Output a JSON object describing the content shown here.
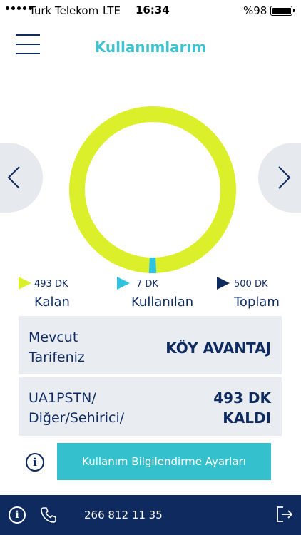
{
  "status_bar": {
    "carrier": "Turk Telekom",
    "network": "LTE",
    "time": "16:34",
    "battery": "%98"
  },
  "header": {
    "title": "Kullanımlarım",
    "menu_icon": "hamburger-menu-icon"
  },
  "usage": {
    "remaining_minutes": 493,
    "used_minutes": 7,
    "total_minutes": 500,
    "colors": {
      "remaining": "#dbef2a",
      "used": "#2fc3e0",
      "total": "#0e2a5e"
    }
  },
  "legend": [
    {
      "value": "493 DK",
      "label": "Kalan"
    },
    {
      "value": "7 DK",
      "label": "Kullanılan"
    },
    {
      "value": "500 DK",
      "label": "Toplam"
    }
  ],
  "card": {
    "tariff_label_1": "Mevcut",
    "tariff_label_2": "Tarifeniz",
    "tariff_value": "KÖY AVANTAJ",
    "package_label_1": "UA1PSTN/",
    "package_label_2": "Diğer/Sehirici/",
    "package_value_1": "493 DK",
    "package_value_2": "KALDI"
  },
  "settings": {
    "info_icon": "i",
    "button_label": "Kullanım Bilgilendirme Ayarları"
  },
  "bottom_bar": {
    "info_icon": "i",
    "phone_number": "266 812 11 35"
  },
  "theme": {
    "navy": "#0e2a5e",
    "teal": "#35c0cd",
    "card_bg": "#e9edf2"
  }
}
